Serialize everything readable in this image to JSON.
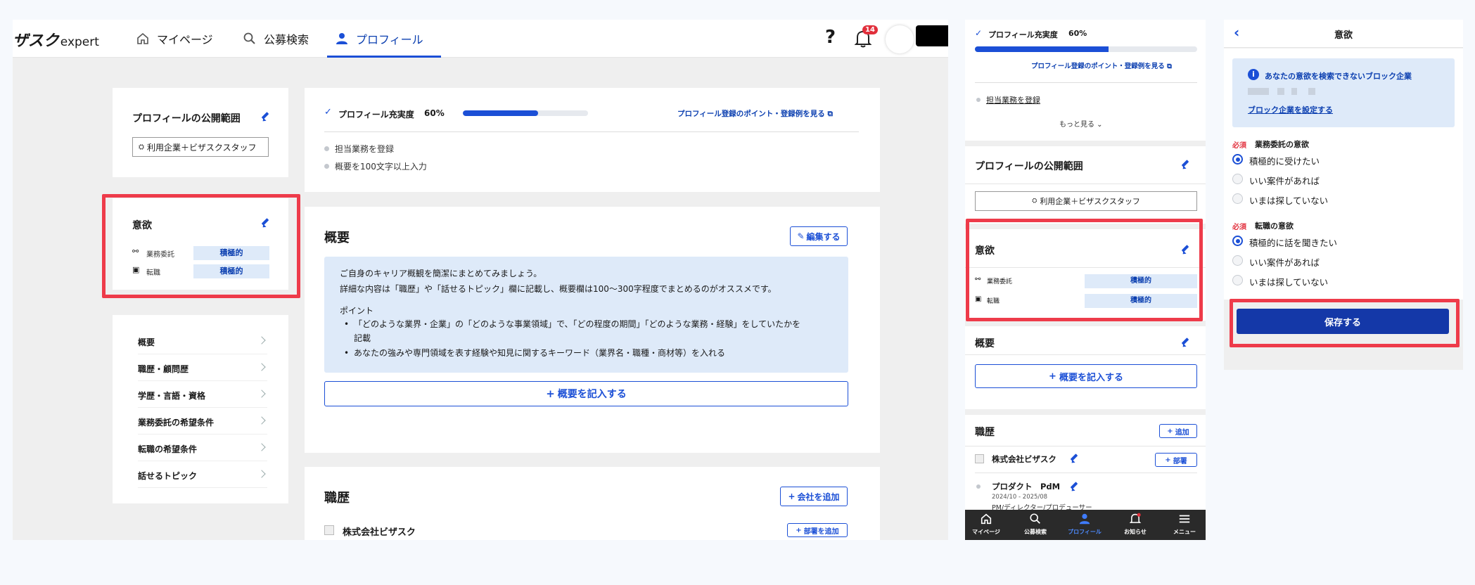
{
  "header": {
    "logo_prefix": "ザスク",
    "logo_suffix": "expert",
    "nav": [
      {
        "label": "マイページ"
      },
      {
        "label": "公募検索"
      },
      {
        "label": "プロフィール"
      }
    ],
    "help": "?",
    "notif_count": "14"
  },
  "left": {
    "scope_title": "プロフィールの公開範囲",
    "scope_value": "利用企業＋ビザスクスタッフ",
    "motive_title": "意欲",
    "motive_rows": [
      {
        "label": "業務委託",
        "value": "積極的"
      },
      {
        "label": "転職",
        "value": "積極的"
      }
    ],
    "menu": [
      "概要",
      "職歴・顧問歴",
      "学歴・言語・資格",
      "業務委託の希望条件",
      "転職の希望条件",
      "話せるトピック"
    ]
  },
  "main": {
    "completion_label": "プロフィール充実度",
    "completion_pct": "60%",
    "completion_value": 0.6,
    "tips_link": "プロフィール登録のポイント・登録例を見る",
    "todo": [
      "担当業務を登録",
      "概要を100文字以上入力"
    ],
    "summary_title": "概要",
    "edit_btn": "編集する",
    "info_line1": "ご自身のキャリア概観を簡潔にまとめてみましょう。",
    "info_line2": "詳細な内容は「職歴」や「話せるトピック」欄に記載し、概要欄は100〜300字程度でまとめるのがオススメです。",
    "point_label": "ポイント",
    "point1a": "「どのような業界・企業」の「どのような事業領域」で、「どの程度の期間」「どのような業務・経験」をしていたかを",
    "point1b": "記載",
    "point2": "あなたの強みや専門領域を表す経験や知見に関するキーワード（業界名・職種・商材等）を入れる",
    "add_summary": "概要を記入する",
    "career_title": "職歴",
    "add_company": "会社を追加",
    "company": "株式会社ビザスク",
    "add_dept": "部署を追加"
  },
  "mobile": {
    "completion_label": "プロフィール充実度",
    "completion_pct": "60%",
    "completion_value": 0.6,
    "tips_link": "プロフィール登録のポイント・登録例を見る",
    "todo": "担当業務を登録",
    "more": "もっと見る",
    "scope_title": "プロフィールの公開範囲",
    "scope_value": "利用企業＋ビザスクスタッフ",
    "motive_title": "意欲",
    "motive_rows": [
      {
        "label": "業務委託",
        "value": "積極的"
      },
      {
        "label": "転職",
        "value": "積極的"
      }
    ],
    "summary_title": "概要",
    "add_summary": "概要を記入する",
    "career_title": "職歴",
    "add": "追加",
    "company": "株式会社ビザスク",
    "dept": "部署",
    "role": "プロダクト　PdM",
    "period": "2024/10 - 2025/08",
    "role_sub": "PM/ディレクター/プロデューサー",
    "tabs": [
      "マイページ",
      "公募検索",
      "プロフィール",
      "お知らせ",
      "メニュー"
    ]
  },
  "modal": {
    "title": "意欲",
    "info_title": "あなたの意欲を検索できないブロック企業",
    "info_link": "ブロック企業を設定する",
    "required": "必須",
    "q1": "業務委託の意欲",
    "q1_opts": [
      "積極的に受けたい",
      "いい案件があれば",
      "いまは探していない"
    ],
    "q2": "転職の意欲",
    "q2_opts": [
      "積極的に話を聞きたい",
      "いい案件があれば",
      "いまは探していない"
    ],
    "save": "保存する"
  },
  "colors": {
    "accent": "#1b4fd6",
    "highlight": "#ee3b4a",
    "navy": "#0b3fb0"
  }
}
